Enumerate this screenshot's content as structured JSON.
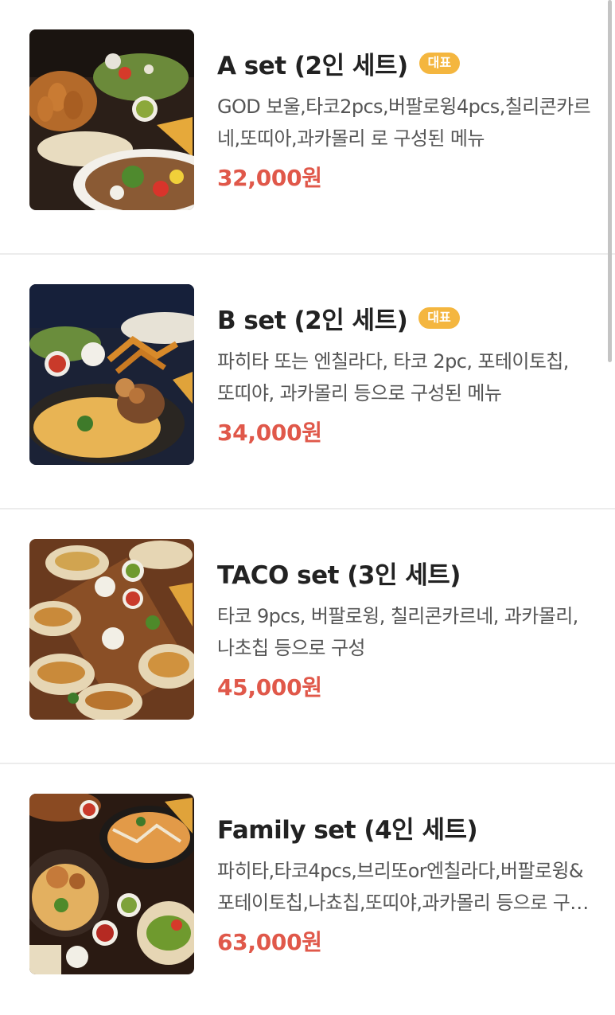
{
  "menu": {
    "items": [
      {
        "name": "A set (2인 세트)",
        "badge": "대표",
        "description": "GOD 보울,타코2pcs,버팔로윙4pcs,칠리콘카르네,또띠아,과카몰리 로 구성된 메뉴",
        "price": "32,000원",
        "image": "a-set-food-photo"
      },
      {
        "name": "B set (2인 세트)",
        "badge": "대표",
        "description": "파히타 또는 엔칠라다, 타코 2pc, 포테이토칩, 또띠야, 과카몰리 등으로 구성된 메뉴",
        "price": "34,000원",
        "image": "b-set-food-photo"
      },
      {
        "name": "TACO set (3인 세트)",
        "badge": "",
        "description": "타코 9pcs, 버팔로윙, 칠리콘카르네, 과카몰리, 나초칩 등으로 구성",
        "price": "45,000원",
        "image": "taco-set-food-photo"
      },
      {
        "name": "Family set (4인 세트)",
        "badge": "",
        "description": "파히타,타코4pcs,브리또or엔칠라다,버팔로윙&포테이토칩,나쵸칩,또띠야,과카몰리 등으로 구성된 메뉴",
        "price": "63,000원",
        "image": "family-set-food-photo"
      }
    ]
  },
  "colors": {
    "price": "#e0584a",
    "badge": "#f4b63f",
    "title": "#222222",
    "description": "#555555"
  }
}
